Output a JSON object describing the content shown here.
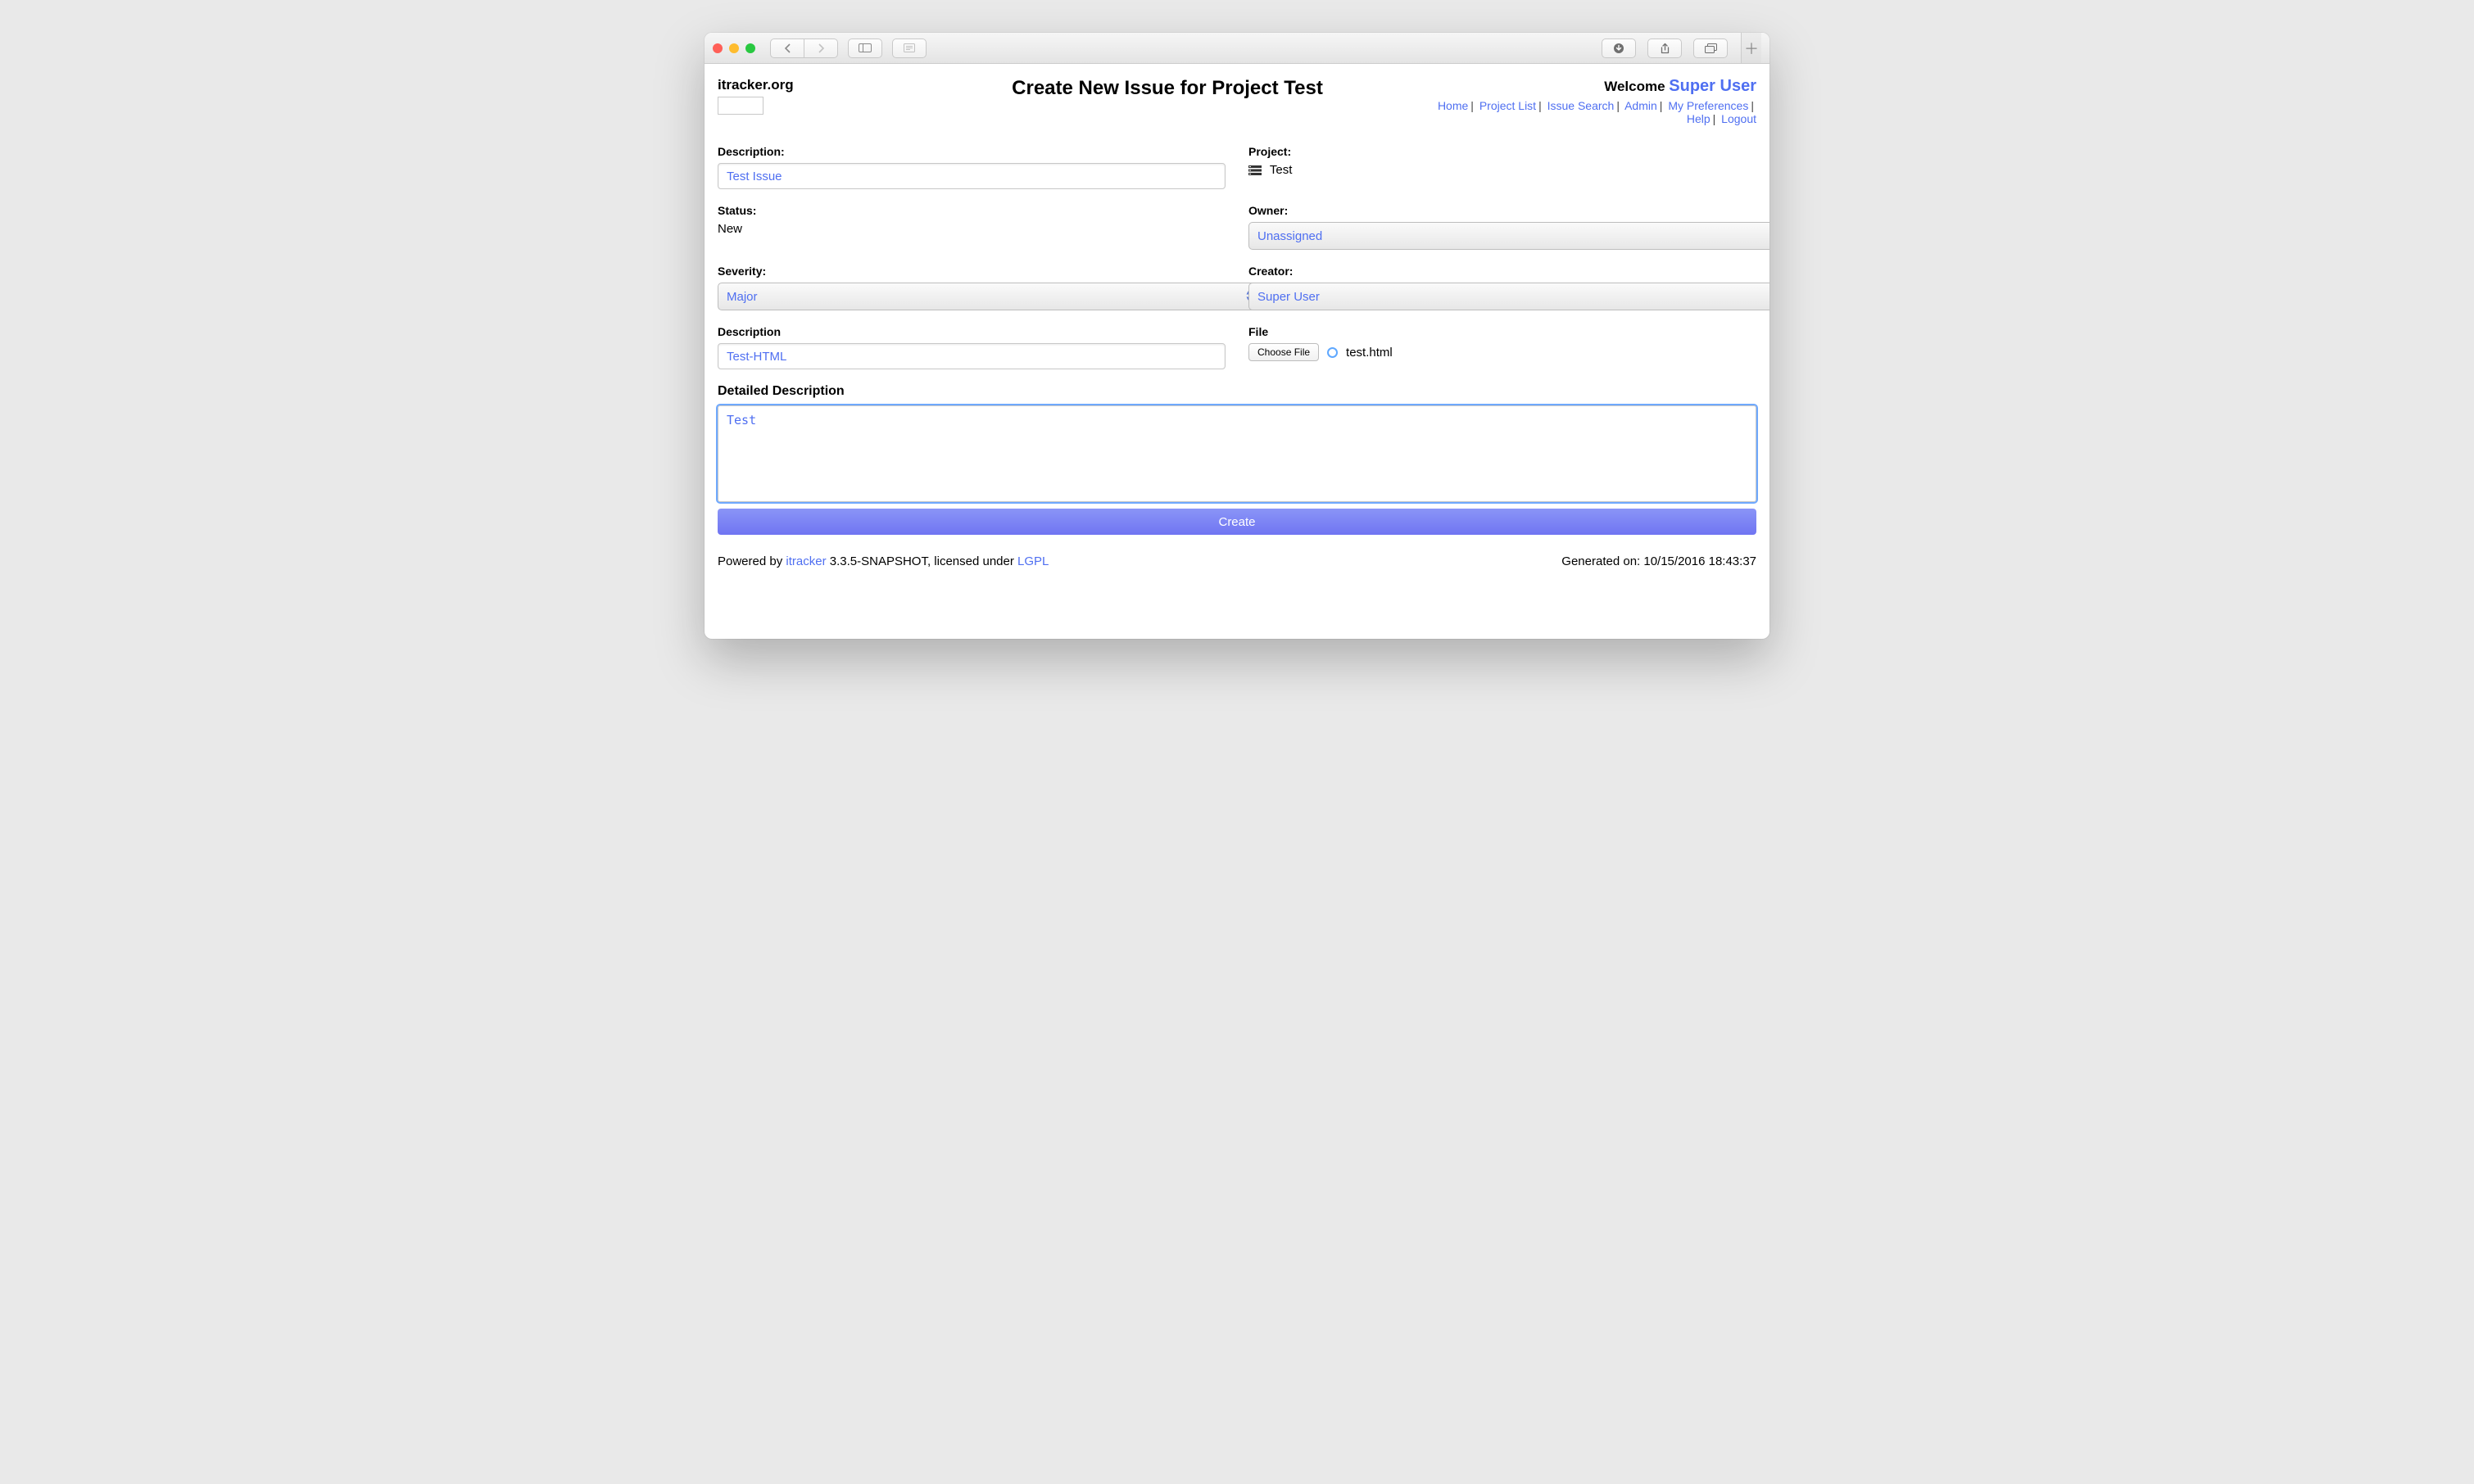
{
  "site_title": "itracker.org",
  "page_title": "Create New Issue for Project Test",
  "welcome_prefix": "Welcome ",
  "user_name": "Super User",
  "nav": [
    "Home",
    "Project List",
    "Issue Search",
    "Admin",
    "My Preferences",
    "Help",
    "Logout"
  ],
  "labels": {
    "description": "Description:",
    "project": "Project:",
    "status": "Status:",
    "owner": "Owner:",
    "severity": "Severity:",
    "creator": "Creator:",
    "file_description": "Description",
    "file": "File",
    "detailed_description": "Detailed Description",
    "choose_file": "Choose File"
  },
  "values": {
    "description": "Test Issue",
    "project": "Test",
    "status": "New",
    "owner": "Unassigned",
    "severity": "Major",
    "creator": "Super User",
    "file_description": "Test-HTML",
    "file_name": "test.html",
    "detailed_description": "Test"
  },
  "buttons": {
    "create": "Create"
  },
  "footer": {
    "powered_by_prefix": "Powered by ",
    "product": "itracker",
    "version_license": " 3.3.5-SNAPSHOT, licensed under ",
    "license": "LGPL",
    "generated": "Generated on: 10/15/2016 18:43:37"
  }
}
